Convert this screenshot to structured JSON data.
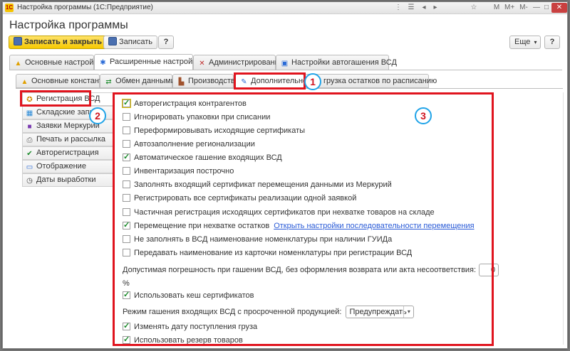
{
  "window": {
    "title": "Настройка программы (1С:Предприятие)",
    "app_icon": "1C"
  },
  "titlebar_controls": [
    "⋮",
    "☰",
    "◂",
    "▸",
    "☆",
    "M",
    "M+",
    "M-",
    "—",
    "□",
    "✕"
  ],
  "page_title": "Настройка программы",
  "toolbar": {
    "save_close_label": "Записать и закрыть",
    "save_label": "Записать",
    "help_label": "?",
    "more_label": "Еще",
    "more_arrow": "▾",
    "help2_label": "?"
  },
  "main_tabs": [
    {
      "label": "Основные настройки",
      "icon": "warning-icon"
    },
    {
      "label": "Расширенные настройки",
      "icon": "gear-icon"
    },
    {
      "label": "Администрирование",
      "icon": "tools-icon"
    },
    {
      "label": "Настройки автогашения ВСД",
      "icon": "monitor-icon"
    }
  ],
  "sub_tabs": [
    {
      "label": "Основные константы",
      "icon": "warning-icon"
    },
    {
      "label": "Обмен данными",
      "icon": "exchange-icon"
    },
    {
      "label": "Производство",
      "icon": "factory-icon"
    },
    {
      "label": "Дополнительно",
      "icon": "wand-icon"
    },
    {
      "label": "грузка остатков по расписанию",
      "icon": ""
    }
  ],
  "sidebar": [
    {
      "label": "Регистрация ВСД",
      "icon": "certificate-icon"
    },
    {
      "label": "Складские запи",
      "icon": "warehouse-icon"
    },
    {
      "label": "Заявки Меркурий",
      "icon": "box-icon"
    },
    {
      "label": "Печать и рассылка",
      "icon": "printer-icon"
    },
    {
      "label": "Авторегистрация",
      "icon": "check-icon"
    },
    {
      "label": "Отображение",
      "icon": "display-icon"
    },
    {
      "label": "Даты выработки",
      "icon": "clock-icon"
    }
  ],
  "settings": {
    "auto_register_contractors": {
      "label": "Авторегистрация контрагентов",
      "checked": true
    },
    "ignore_packaging": {
      "label": "Игнорировать упаковки при списании",
      "checked": false
    },
    "reform_outgoing": {
      "label": "Переформировывать исходящие сертификаты",
      "checked": false
    },
    "autofill_regionalization": {
      "label": "Автозаполнение регионализации",
      "checked": false
    },
    "auto_redeem_incoming": {
      "label": "Автоматическое гашение входящих ВСД",
      "checked": true
    },
    "inventory_line_by_line": {
      "label": "Инвентаризация построчно",
      "checked": false
    },
    "fill_incoming_move_cert": {
      "label": "Заполнять входящий сертификат перемещения данными из Меркурий",
      "checked": false
    },
    "register_all_sales_one_request": {
      "label": "Регистрировать все сертификаты реализации одной заявкой",
      "checked": false
    },
    "partial_registration": {
      "label": "Частичная регистрация исходящих сертификатов при нехватке товаров на складе",
      "checked": false
    },
    "move_on_shortage": {
      "label": "Перемещение при нехватке остатков",
      "checked": true,
      "link": "Открыть настройки последовательности перемещения"
    },
    "no_nomenclature_with_guid": {
      "label": "Не заполнять в ВСД наименование номенклатуры при наличии ГУИДа",
      "checked": false
    },
    "pass_name_from_card": {
      "label": "Передавать наименование из карточки номенклатуры при регистрации ВСД",
      "checked": false
    },
    "tolerance": {
      "label": "Допустимая погрешность при гашении ВСД, без оформления возврата или акта несоответствия:",
      "value": "0",
      "unit": "%"
    },
    "use_cert_cache": {
      "label": "Использовать кеш сертификатов",
      "checked": true
    },
    "expired_mode": {
      "label": "Режим гашения входящих ВСД с просроченной продукцией:",
      "value": "Предупреждать",
      "arrow": "▾"
    },
    "change_receipt_date": {
      "label": "Изменять дату поступления груза",
      "checked": true
    },
    "use_goods_reserve": {
      "label": "Использовать резерв товаров",
      "checked": true
    }
  },
  "annotations": {
    "badge1": "1",
    "badge2": "2",
    "badge3": "3"
  },
  "colors": {
    "accent": "#f6c900",
    "highlight": "#e0141e",
    "badge_ring": "#1fa3e8",
    "link": "#2a5bd7"
  }
}
